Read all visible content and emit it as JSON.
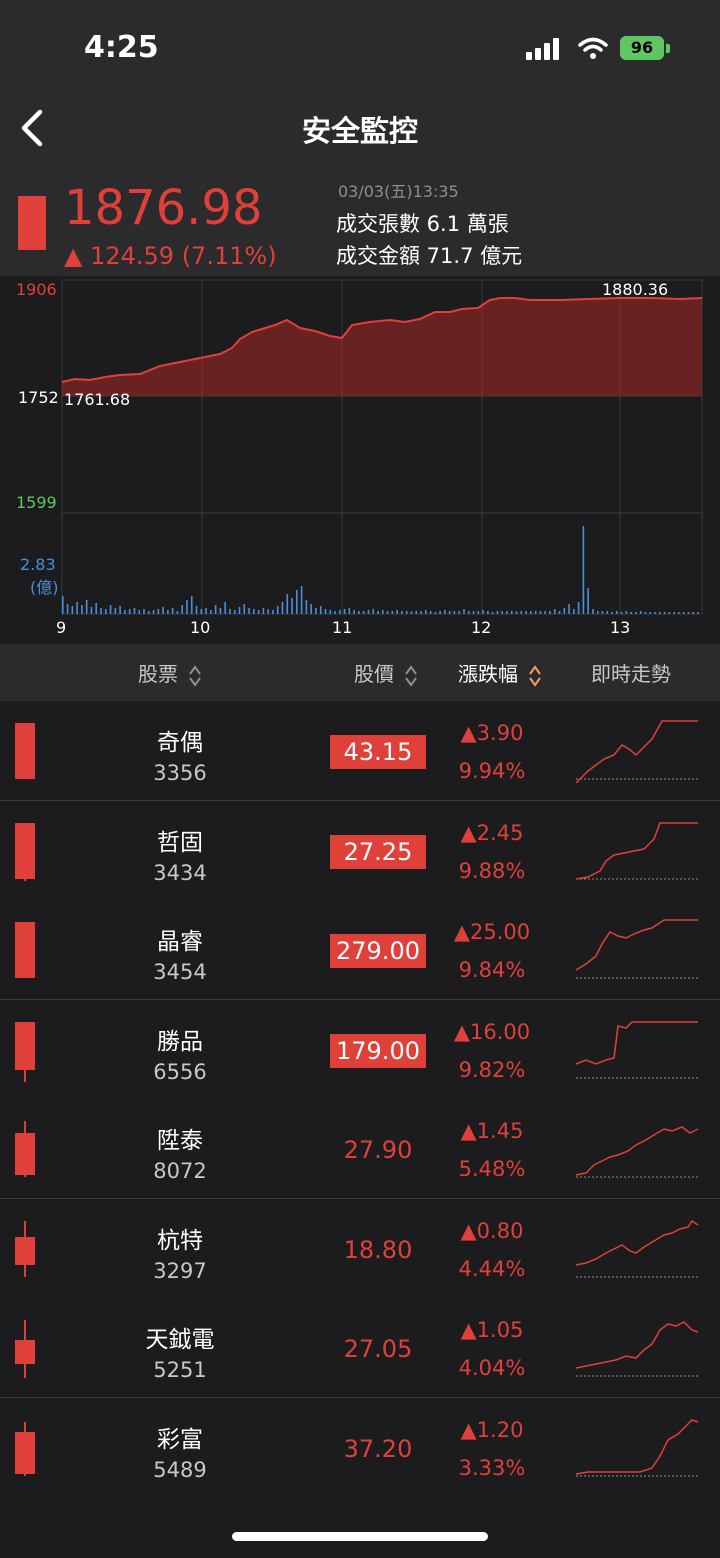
{
  "status": {
    "time": "4:25",
    "battery": "96"
  },
  "nav": {
    "title": "安全監控"
  },
  "quote": {
    "price": "1876.98",
    "change": "▲ 124.59 (7.11%)",
    "datetime": "03/03(五)13:35",
    "volume": "成交張數  6.1 萬張",
    "amount": "成交金額  71.7 億元",
    "color_up": "#e0403a"
  },
  "chart": {
    "y_top": "1906",
    "y_mid": "1752",
    "y_low": "1599",
    "vol_max": "2.83",
    "vol_unit": "(億)",
    "open_label": "1761.68",
    "high_label": "1880.36",
    "x_ticks": [
      "9",
      "10",
      "11",
      "12",
      "13"
    ]
  },
  "table_header": {
    "stock": "股票",
    "price": "股價",
    "change": "漲跌幅",
    "trend": "即時走勢"
  },
  "rows": [
    {
      "name": "奇偶",
      "code": "3356",
      "price": "43.15",
      "change": "▲3.90",
      "pct": "9.94%",
      "limit": true
    },
    {
      "name": "哲固",
      "code": "3434",
      "price": "27.25",
      "change": "▲2.45",
      "pct": "9.88%",
      "limit": true
    },
    {
      "name": "晶睿",
      "code": "3454",
      "price": "279.00",
      "change": "▲25.00",
      "pct": "9.84%",
      "limit": true
    },
    {
      "name": "勝品",
      "code": "6556",
      "price": "179.00",
      "change": "▲16.00",
      "pct": "9.82%",
      "limit": true
    },
    {
      "name": "陞泰",
      "code": "8072",
      "price": "27.90",
      "change": "▲1.45",
      "pct": "5.48%",
      "limit": false
    },
    {
      "name": "杭特",
      "code": "3297",
      "price": "18.80",
      "change": "▲0.80",
      "pct": "4.44%",
      "limit": false
    },
    {
      "name": "天鉞電",
      "code": "5251",
      "price": "27.05",
      "change": "▲1.05",
      "pct": "4.04%",
      "limit": false
    },
    {
      "name": "彩富",
      "code": "5489",
      "price": "37.20",
      "change": "▲1.20",
      "pct": "3.33%",
      "limit": false
    }
  ]
}
